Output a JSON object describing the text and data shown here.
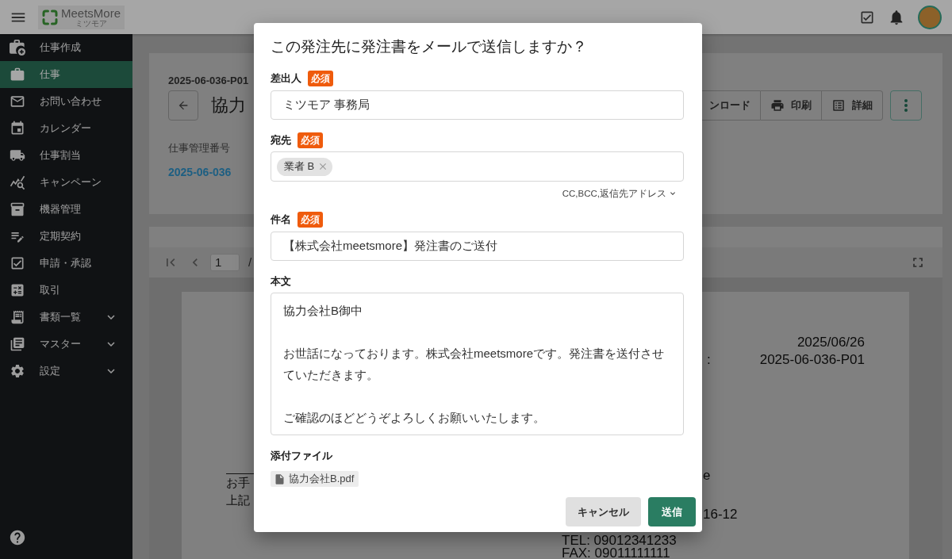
{
  "header": {
    "logo": {
      "wordmark": "MeetsMore",
      "tagline": "ミツモア"
    }
  },
  "sidebar": {
    "items": [
      {
        "label": "仕事作成",
        "kind": "link",
        "selected": false
      },
      {
        "label": "仕事",
        "kind": "link",
        "selected": true
      },
      {
        "label": "お問い合わせ",
        "kind": "link",
        "selected": false
      },
      {
        "label": "カレンダー",
        "kind": "link",
        "selected": false
      },
      {
        "label": "仕事割当",
        "kind": "link",
        "selected": false
      },
      {
        "label": "キャンペーン",
        "kind": "link",
        "selected": false
      },
      {
        "label": "機器管理",
        "kind": "link",
        "selected": false
      },
      {
        "label": "定期契約",
        "kind": "link",
        "selected": false
      },
      {
        "label": "申請・承認",
        "kind": "link",
        "selected": false
      },
      {
        "label": "取引",
        "kind": "link",
        "selected": false
      },
      {
        "label": "書類一覧",
        "kind": "group",
        "selected": false,
        "expanded": false
      },
      {
        "label": "マスター",
        "kind": "group",
        "selected": false,
        "expanded": false
      },
      {
        "label": "設定",
        "kind": "group",
        "selected": false,
        "expanded": false
      }
    ]
  },
  "job": {
    "code": "2025-06-036-P01",
    "title": "協力",
    "actions": [
      {
        "label": "ンロード"
      },
      {
        "label": "印刷"
      },
      {
        "label": "詳細"
      }
    ],
    "detail": {
      "label": "仕事管理番号",
      "value": "2025-06-036"
    }
  },
  "viewer": {
    "page_input": "1",
    "separator": "/",
    "document": {
      "date": "2025/06/26",
      "number_label": ":",
      "number": "2025-06-036-P01",
      "left_lines": [
        "お手",
        "上記"
      ],
      "right_lines": [
        "e",
        "16-12"
      ],
      "contact_lines": [
        "TEL: 09012341233",
        "FAX: 09011111111"
      ]
    }
  },
  "dialog": {
    "title": "この発注先に発注書をメールで送信しますか？",
    "fields": [
      {
        "kind": "text",
        "label": "差出人",
        "badge": "必須",
        "value": "ミツモア 事務局"
      },
      {
        "kind": "chips",
        "label": "宛先",
        "badge": "必須",
        "chips": [
          "業者 B"
        ],
        "more_link": "CC,BCC,返信先アドレス"
      },
      {
        "kind": "text",
        "label": "件名",
        "badge": "必須",
        "value": "【株式会社meetsmore】発注書のご送付"
      },
      {
        "kind": "textarea",
        "label": "本文",
        "paragraphs": [
          "協力会社B御中",
          "お世話になっております。株式会社meetsmoreです。発注書を送付させていただきます。",
          "ご確認のほどどうぞよろしくお願いいたします。"
        ]
      },
      {
        "kind": "files",
        "label": "添付ファイル",
        "files": [
          "協力会社B.pdf"
        ]
      }
    ],
    "buttons": [
      {
        "label": "キャンセル",
        "kind": "secondary"
      },
      {
        "label": "送信",
        "kind": "primary"
      }
    ]
  }
}
